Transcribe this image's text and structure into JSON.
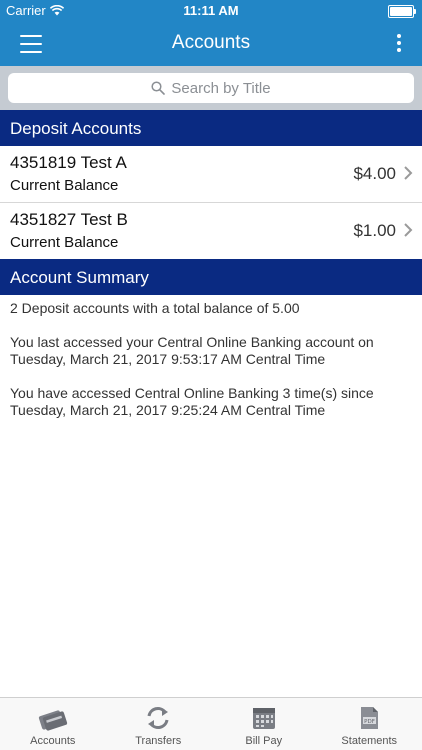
{
  "status_bar": {
    "carrier": "Carrier",
    "time": "11:11 AM"
  },
  "nav": {
    "title": "Accounts"
  },
  "search": {
    "placeholder": "Search by Title"
  },
  "deposit_section": {
    "title": "Deposit Accounts"
  },
  "accounts": [
    {
      "name": "4351819 Test A",
      "balance_label": "Current Balance",
      "amount": "$4.00"
    },
    {
      "name": "4351827 Test B",
      "balance_label": "Current Balance",
      "amount": "$1.00"
    }
  ],
  "summary_section": {
    "title": "Account Summary",
    "total_line": "2 Deposit accounts with a total balance of 5.00",
    "last_access_line1": "You last accessed your Central Online Banking account on",
    "last_access_line2": "Tuesday, March 21, 2017 9:53:17 AM Central Time",
    "access_count_line1": "You have accessed Central Online Banking 3 time(s) since",
    "access_count_line2": "Tuesday, March 21, 2017 9:25:24 AM Central Time"
  },
  "tabs": [
    {
      "label": "Accounts",
      "icon": "cards-icon"
    },
    {
      "label": "Transfers",
      "icon": "transfer-icon"
    },
    {
      "label": "Bill Pay",
      "icon": "calendar-icon"
    },
    {
      "label": "Statements",
      "icon": "pdf-icon"
    }
  ],
  "colors": {
    "brand_blue": "#2286c6",
    "section_navy": "#0a2a82"
  }
}
